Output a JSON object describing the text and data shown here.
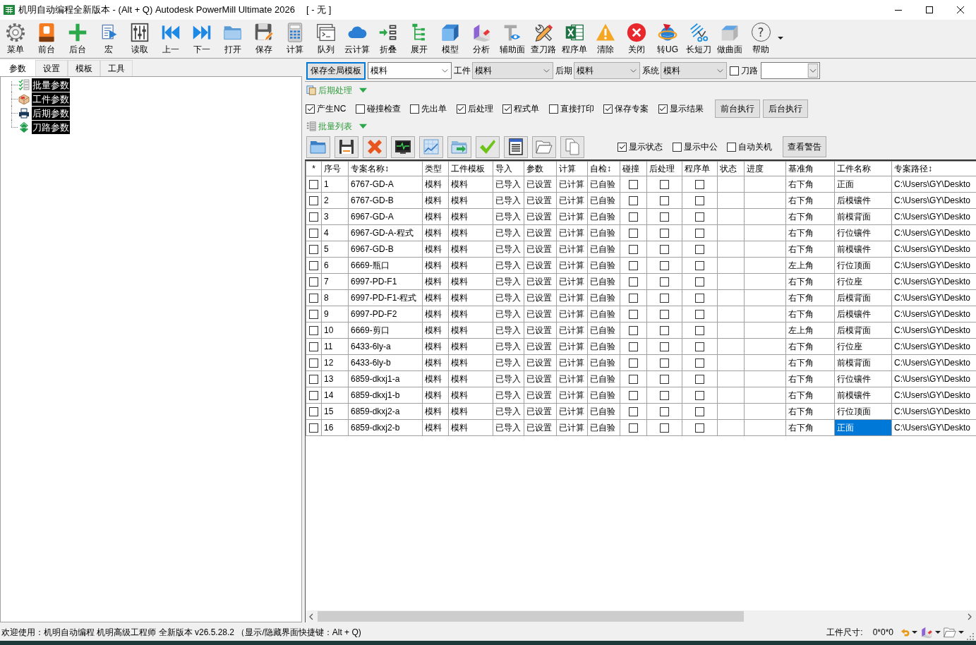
{
  "window": {
    "title": "机明自动编程全新版本 - (Alt + Q) Autodesk PowerMill Ultimate 2026",
    "document": "[ - 无 ]"
  },
  "toolbar": {
    "items": [
      {
        "label": "菜单"
      },
      {
        "label": "前台"
      },
      {
        "label": "后台"
      },
      {
        "label": "宏"
      },
      {
        "label": "读取"
      },
      {
        "label": "上一"
      },
      {
        "label": "下一"
      },
      {
        "label": "打开"
      },
      {
        "label": "保存"
      },
      {
        "label": "计算"
      },
      {
        "label": "队列"
      },
      {
        "label": "云计算"
      },
      {
        "label": "折叠"
      },
      {
        "label": "展开"
      },
      {
        "label": "模型"
      },
      {
        "label": "分析"
      },
      {
        "label": "辅助面"
      },
      {
        "label": "查刀路"
      },
      {
        "label": "程序单"
      },
      {
        "label": "清除"
      },
      {
        "label": "关闭"
      },
      {
        "label": "转UG"
      },
      {
        "label": "长短刀"
      },
      {
        "label": "做曲面"
      },
      {
        "label": "帮助",
        "glyph": "?"
      }
    ]
  },
  "left_panel": {
    "tabs": [
      {
        "label": "参数",
        "selected": true
      },
      {
        "label": "设置",
        "selected": false
      },
      {
        "label": "模板",
        "selected": false
      },
      {
        "label": "工具",
        "selected": false
      }
    ],
    "tree": [
      {
        "label": "批量参数",
        "selected": true
      },
      {
        "label": "工件参数",
        "selected": true
      },
      {
        "label": "后期参数",
        "selected": true
      },
      {
        "label": "刀路参数",
        "selected": true
      }
    ]
  },
  "template_bar": {
    "save_button": {
      "label": "保存全局模板",
      "focused": true
    },
    "template": {
      "value": "模料",
      "editable": true
    },
    "selectors": [
      {
        "label": "工件",
        "value": "模料",
        "editable": false
      },
      {
        "label": "后期",
        "value": "模料",
        "editable": false
      },
      {
        "label": "系统",
        "value": "模料",
        "editable": false
      }
    ],
    "toolpath": {
      "label": "刀路",
      "checked": false,
      "editable": true
    }
  },
  "post_section": {
    "title": "后期处理",
    "expanded": true,
    "options": [
      {
        "label": "产生NC",
        "checked": true
      },
      {
        "label": "碰撞检查",
        "checked": false
      },
      {
        "label": "先出单",
        "checked": false
      },
      {
        "label": "后处理",
        "checked": true
      },
      {
        "label": "程式单",
        "checked": true
      },
      {
        "label": "直接打印",
        "checked": false
      },
      {
        "label": "保存专案",
        "checked": true
      },
      {
        "label": "显示结果",
        "checked": true
      }
    ],
    "buttons": [
      "前台执行",
      "后台执行"
    ]
  },
  "batch_section": {
    "title": "批量列表",
    "expanded": true,
    "options": [
      {
        "label": "显示状态",
        "checked": true
      },
      {
        "label": "显示中公",
        "checked": false
      },
      {
        "label": "自动关机",
        "checked": false
      }
    ],
    "buttons": [
      "查看警告"
    ]
  },
  "table": {
    "columns": [
      "*",
      "序号",
      "专案名称↕",
      "类型",
      "工件模板",
      "导入",
      "参数",
      "计算",
      "自检↕",
      "碰撞",
      "后处理",
      "程序单",
      "状态",
      "进度",
      "基准角",
      "工件名称",
      "专案路径↕"
    ],
    "rows": [
      {
        "checked": false,
        "number": "1",
        "name": "6767-GD-A",
        "type": "模料",
        "template": "模料",
        "import": "已导入",
        "params": "已设置",
        "calc": "已计算",
        "self_check": "已自验",
        "collision": false,
        "post": false,
        "program": false,
        "corner": "右下角",
        "part_name": "正面",
        "part_name_selected": false,
        "path": "C:\\Users\\GY\\Deskto"
      },
      {
        "checked": false,
        "number": "2",
        "name": "6767-GD-B",
        "type": "模料",
        "template": "模料",
        "import": "已导入",
        "params": "已设置",
        "calc": "已计算",
        "self_check": "已自验",
        "collision": false,
        "post": false,
        "program": false,
        "corner": "右下角",
        "part_name": "后模镶件",
        "part_name_selected": false,
        "path": "C:\\Users\\GY\\Deskto"
      },
      {
        "checked": false,
        "number": "3",
        "name": "6967-GD-A",
        "type": "模料",
        "template": "模料",
        "import": "已导入",
        "params": "已设置",
        "calc": "已计算",
        "self_check": "已自验",
        "collision": false,
        "post": false,
        "program": false,
        "corner": "右下角",
        "part_name": "前模背面",
        "part_name_selected": false,
        "path": "C:\\Users\\GY\\Deskto"
      },
      {
        "checked": false,
        "number": "4",
        "name": "6967-GD-A-程式",
        "type": "模料",
        "template": "模料",
        "import": "已导入",
        "params": "已设置",
        "calc": "已计算",
        "self_check": "已自验",
        "collision": false,
        "post": false,
        "program": false,
        "corner": "右下角",
        "part_name": "行位镶件",
        "part_name_selected": false,
        "path": "C:\\Users\\GY\\Deskto"
      },
      {
        "checked": false,
        "number": "5",
        "name": "6967-GD-B",
        "type": "模料",
        "template": "模料",
        "import": "已导入",
        "params": "已设置",
        "calc": "已计算",
        "self_check": "已自验",
        "collision": false,
        "post": false,
        "program": false,
        "corner": "右下角",
        "part_name": "前模镶件",
        "part_name_selected": false,
        "path": "C:\\Users\\GY\\Deskto"
      },
      {
        "checked": false,
        "number": "6",
        "name": "6669-瓶口",
        "type": "模料",
        "template": "模料",
        "import": "已导入",
        "params": "已设置",
        "calc": "已计算",
        "self_check": "已自验",
        "collision": false,
        "post": false,
        "program": false,
        "corner": "左上角",
        "part_name": "行位顶面",
        "part_name_selected": false,
        "path": "C:\\Users\\GY\\Deskto"
      },
      {
        "checked": false,
        "number": "7",
        "name": "6997-PD-F1",
        "type": "模料",
        "template": "模料",
        "import": "已导入",
        "params": "已设置",
        "calc": "已计算",
        "self_check": "已自验",
        "collision": false,
        "post": false,
        "program": false,
        "corner": "右下角",
        "part_name": "行位座",
        "part_name_selected": false,
        "path": "C:\\Users\\GY\\Deskto"
      },
      {
        "checked": false,
        "number": "8",
        "name": "6997-PD-F1-程式",
        "type": "模料",
        "template": "模料",
        "import": "已导入",
        "params": "已设置",
        "calc": "已计算",
        "self_check": "已自验",
        "collision": false,
        "post": false,
        "program": false,
        "corner": "右下角",
        "part_name": "后模背面",
        "part_name_selected": false,
        "path": "C:\\Users\\GY\\Deskto"
      },
      {
        "checked": false,
        "number": "9",
        "name": "6997-PD-F2",
        "type": "模料",
        "template": "模料",
        "import": "已导入",
        "params": "已设置",
        "calc": "已计算",
        "self_check": "已自验",
        "collision": false,
        "post": false,
        "program": false,
        "corner": "右下角",
        "part_name": "后模镶件",
        "part_name_selected": false,
        "path": "C:\\Users\\GY\\Deskto"
      },
      {
        "checked": false,
        "number": "10",
        "name": "6669-剪口",
        "type": "模料",
        "template": "模料",
        "import": "已导入",
        "params": "已设置",
        "calc": "已计算",
        "self_check": "已自验",
        "collision": false,
        "post": false,
        "program": false,
        "corner": "左上角",
        "part_name": "后模背面",
        "part_name_selected": false,
        "path": "C:\\Users\\GY\\Deskto"
      },
      {
        "checked": false,
        "number": "11",
        "name": "6433-6ly-a",
        "type": "模料",
        "template": "模料",
        "import": "已导入",
        "params": "已设置",
        "calc": "已计算",
        "self_check": "已自验",
        "collision": false,
        "post": false,
        "program": false,
        "corner": "右下角",
        "part_name": "行位座",
        "part_name_selected": false,
        "path": "C:\\Users\\GY\\Deskto"
      },
      {
        "checked": false,
        "number": "12",
        "name": "6433-6ly-b",
        "type": "模料",
        "template": "模料",
        "import": "已导入",
        "params": "已设置",
        "calc": "已计算",
        "self_check": "已自验",
        "collision": false,
        "post": false,
        "program": false,
        "corner": "右下角",
        "part_name": "前模背面",
        "part_name_selected": false,
        "path": "C:\\Users\\GY\\Deskto"
      },
      {
        "checked": false,
        "number": "13",
        "name": "6859-dkxj1-a",
        "type": "模料",
        "template": "模料",
        "import": "已导入",
        "params": "已设置",
        "calc": "已计算",
        "self_check": "已自验",
        "collision": false,
        "post": false,
        "program": false,
        "corner": "右下角",
        "part_name": "行位镶件",
        "part_name_selected": false,
        "path": "C:\\Users\\GY\\Deskto"
      },
      {
        "checked": false,
        "number": "14",
        "name": "6859-dkxj1-b",
        "type": "模料",
        "template": "模料",
        "import": "已导入",
        "params": "已设置",
        "calc": "已计算",
        "self_check": "已自验",
        "collision": false,
        "post": false,
        "program": false,
        "corner": "右下角",
        "part_name": "前模镶件",
        "part_name_selected": false,
        "path": "C:\\Users\\GY\\Deskto"
      },
      {
        "checked": false,
        "number": "15",
        "name": "6859-dkxj2-a",
        "type": "模料",
        "template": "模料",
        "import": "已导入",
        "params": "已设置",
        "calc": "已计算",
        "self_check": "已自验",
        "collision": false,
        "post": false,
        "program": false,
        "corner": "右下角",
        "part_name": "行位顶面",
        "part_name_selected": false,
        "path": "C:\\Users\\GY\\Deskto"
      },
      {
        "checked": false,
        "number": "16",
        "name": "6859-dkxj2-b",
        "type": "模料",
        "template": "模料",
        "import": "已导入",
        "params": "已设置",
        "calc": "已计算",
        "self_check": "已自验",
        "collision": false,
        "post": false,
        "program": false,
        "corner": "右下角",
        "part_name": "正面",
        "part_name_selected": true,
        "path": "C:\\Users\\GY\\Deskto"
      }
    ]
  },
  "status_bar": {
    "message": "欢迎使用：机明自动编程 机明高级工程师 全新版本 v26.5.28.2 （显示/隐藏界面快捷键：Alt + Q)",
    "size_label": "工件尺寸:",
    "size_value": "0*0*0"
  }
}
